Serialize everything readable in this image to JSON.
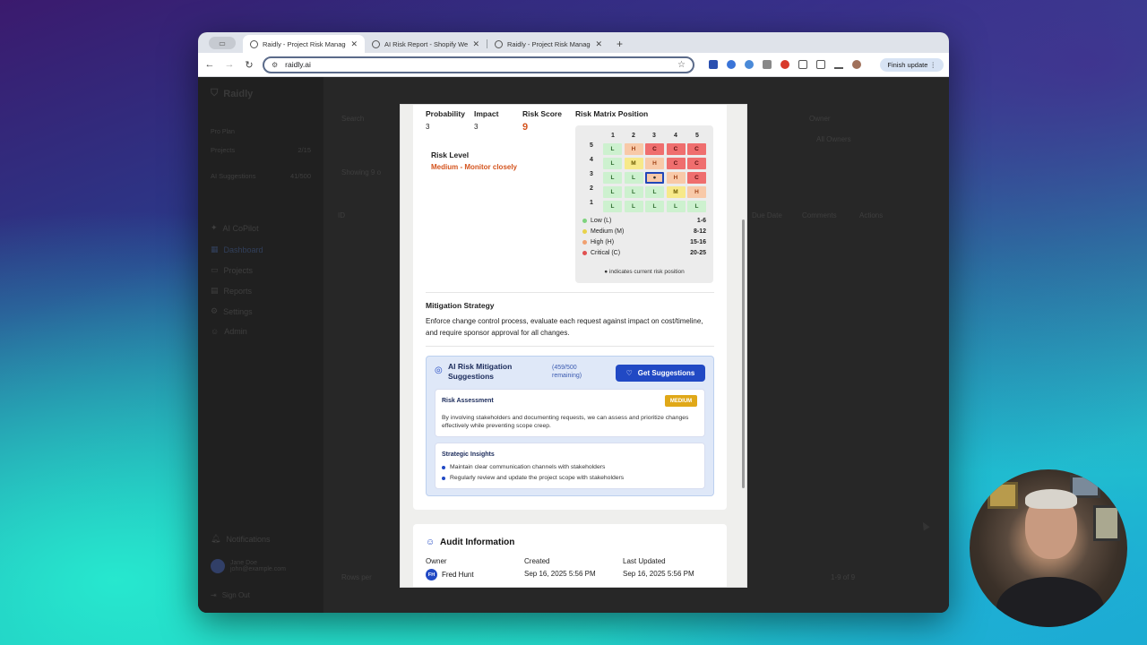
{
  "browser": {
    "tabs": [
      {
        "title": "Raidly - Project Risk Managem",
        "active": true
      },
      {
        "title": "AI Risk Report - Shopify Webs",
        "active": false
      },
      {
        "title": "Raidly - Project Risk Managem",
        "active": false
      }
    ],
    "url": "raidly.ai",
    "finish_update": "Finish update"
  },
  "sidebar": {
    "logo": "Raidly",
    "plan": "Pro Plan",
    "projects_label": "Projects",
    "projects_count": "2/15",
    "ai_label": "AI Suggestions",
    "ai_count": "41/500",
    "nav": [
      "AI CoPilot",
      "Dashboard",
      "Projects",
      "Reports",
      "Settings",
      "Admin"
    ],
    "notifications": "Notifications",
    "user_name": "Jane Doe",
    "user_email": "john@example.com",
    "sign_out": "Sign Out"
  },
  "background": {
    "search_label": "Search",
    "owner_label": "Owner",
    "owner_value": "All Owners",
    "showing": "Showing 9 o",
    "col_id": "ID",
    "col_due": "Due Date",
    "col_comments": "Comments",
    "col_actions": "Actions",
    "rows_per_page": "Rows per",
    "pagination": "1-9 of 9"
  },
  "modal": {
    "probability_label": "Probability",
    "probability_value": "3",
    "impact_label": "Impact",
    "impact_value": "3",
    "score_label": "Risk Score",
    "score_value": "9",
    "matrix_label": "Risk Matrix Position",
    "risk_level_label": "Risk Level",
    "risk_level_value": "Medium - Monitor closely",
    "matrix": {
      "cols": [
        "1",
        "2",
        "3",
        "4",
        "5"
      ],
      "rows": [
        {
          "label": "5",
          "cells": [
            "L",
            "H",
            "C",
            "C",
            "C"
          ]
        },
        {
          "label": "4",
          "cells": [
            "L",
            "M",
            "H",
            "C",
            "C"
          ]
        },
        {
          "label": "3",
          "cells": [
            "L",
            "L",
            "●",
            "H",
            "C"
          ]
        },
        {
          "label": "2",
          "cells": [
            "L",
            "L",
            "L",
            "M",
            "H"
          ]
        },
        {
          "label": "1",
          "cells": [
            "L",
            "L",
            "L",
            "L",
            "L"
          ]
        }
      ],
      "legend": [
        {
          "label": "Low (L)",
          "range": "1-6",
          "color": "#7ed37e"
        },
        {
          "label": "Medium (M)",
          "range": "8-12",
          "color": "#e8d24a"
        },
        {
          "label": "High (H)",
          "range": "15-16",
          "color": "#f0a070"
        },
        {
          "label": "Critical (C)",
          "range": "20-25",
          "color": "#e05050"
        }
      ],
      "note": "● indicates current risk position"
    },
    "mitigation_label": "Mitigation Strategy",
    "mitigation_text": "Enforce change control process, evaluate each request against impact on cost/timeline, and require sponsor approval for all changes.",
    "ai": {
      "title": "AI Risk Mitigation Suggestions",
      "remaining": "(459/500 remaining)",
      "button": "Get Suggestions",
      "assessment_label": "Risk Assessment",
      "assessment_badge": "MEDIUM",
      "assessment_text": "By involving stakeholders and documenting requests, we can assess and prioritize changes effectively while preventing scope creep.",
      "insights_label": "Strategic Insights",
      "insights": [
        "Maintain clear communication channels with stakeholders",
        "Regularly review and update the project scope with stakeholders"
      ]
    },
    "audit": {
      "title": "Audit Information",
      "owner_label": "Owner",
      "owner_initials": "FH",
      "owner_name": "Fred Hunt",
      "created_label": "Created",
      "created_value": "Sep 16, 2025 5:56 PM",
      "updated_label": "Last Updated",
      "updated_value": "Sep 16, 2025 5:56 PM"
    }
  }
}
